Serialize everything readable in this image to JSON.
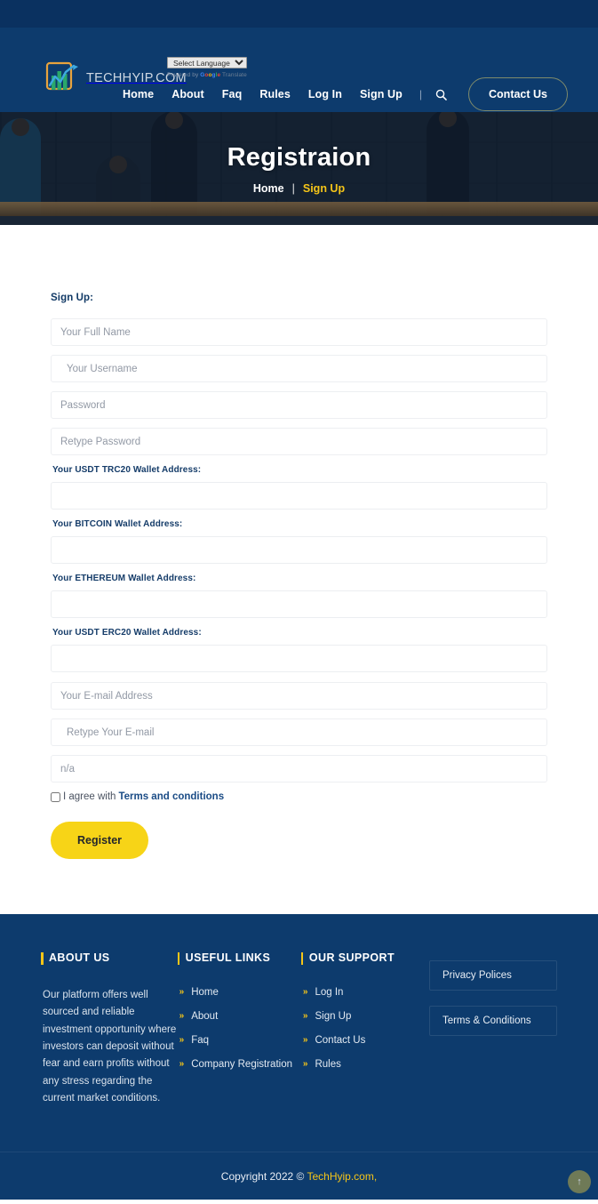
{
  "site": {
    "logo_text": "TECHHYIP.COM",
    "brand_color": "#f5c518",
    "header_bg": "#0d3b6d",
    "topbar_bg": "#0a3160"
  },
  "translate": {
    "selected": "Select Language",
    "powered_by": "Powered by",
    "google": "Google",
    "translate_word": "Translate"
  },
  "nav": {
    "items": [
      {
        "label": "Home"
      },
      {
        "label": "About"
      },
      {
        "label": "Faq"
      },
      {
        "label": "Rules"
      },
      {
        "label": "Log In"
      },
      {
        "label": "Sign Up"
      }
    ],
    "divider": "|",
    "search_icon": "search-icon",
    "contact_label": "Contact Us"
  },
  "hero": {
    "title": "Registraion",
    "breadcrumb_home": "Home",
    "breadcrumb_sep": "|",
    "breadcrumb_current": "Sign Up"
  },
  "form": {
    "title": "Sign Up:",
    "fields": [
      {
        "name": "full-name",
        "placeholder": "Your Full Name",
        "value": ""
      },
      {
        "name": "username",
        "placeholder": "Your Username",
        "value": ""
      },
      {
        "name": "password",
        "placeholder": "Password",
        "value": ""
      },
      {
        "name": "retype-password",
        "placeholder": "Retype Password",
        "value": ""
      }
    ],
    "wallets": [
      {
        "label": "Your USDT TRC20 Wallet Address:",
        "value": ""
      },
      {
        "label": "Your BITCOIN Wallet Address:",
        "value": ""
      },
      {
        "label": "Your ETHEREUM Wallet Address:",
        "value": ""
      },
      {
        "label": "Your USDT ERC20 Wallet Address:",
        "value": ""
      }
    ],
    "email_placeholder": "Your E-mail Address",
    "email_retype_placeholder": "Retype Your E-mail",
    "na_placeholder": "n/a",
    "agree_text": "I agree with ",
    "terms_link": "Terms and conditions",
    "register_label": "Register"
  },
  "footer": {
    "about": {
      "heading": "ABOUT US",
      "text": "Our platform offers well sourced and reliable investment opportunity where investors can deposit without fear and earn profits without any stress regarding the current market conditions."
    },
    "useful": {
      "heading": "USEFUL LINKS",
      "links": [
        {
          "label": "Home"
        },
        {
          "label": "About"
        },
        {
          "label": "Faq"
        },
        {
          "label": "Company Registration"
        }
      ]
    },
    "support": {
      "heading": "OUR SUPPORT",
      "links": [
        {
          "label": "Log In"
        },
        {
          "label": "Sign Up"
        },
        {
          "label": "Contact Us"
        },
        {
          "label": "Rules"
        }
      ]
    },
    "policy": {
      "privacy": "Privacy Polices",
      "terms": "Terms & Conditions"
    },
    "copyright_prefix": "Copyright 2022 © ",
    "copyright_brand": "TechHyip.com,",
    "to_top_icon": "arrow-up-icon"
  }
}
